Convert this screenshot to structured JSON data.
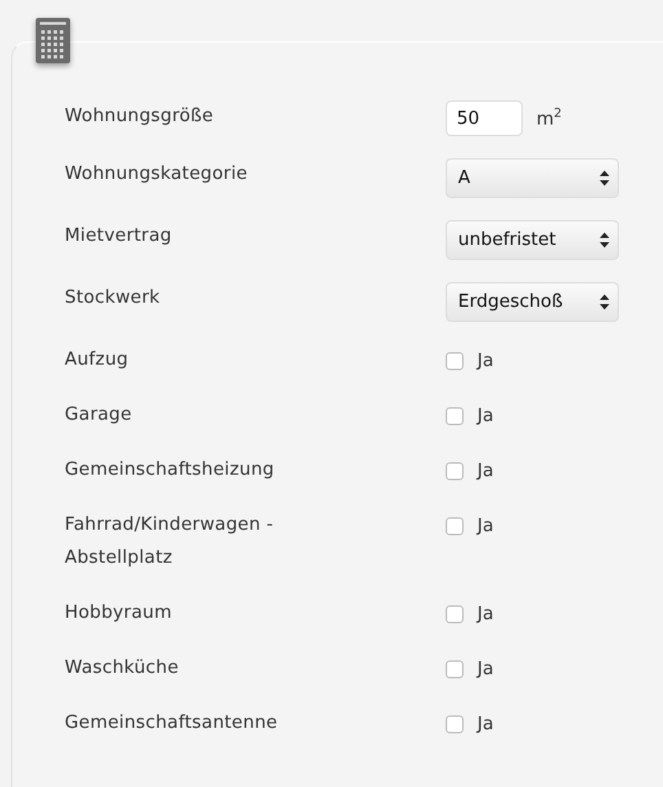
{
  "fields": [
    {
      "kind": "number",
      "label": "Wohnungsgröße",
      "value": "50",
      "unit": "m$^{2}$"
    },
    {
      "kind": "select",
      "label": "Wohnungskategorie",
      "value": "A"
    },
    {
      "kind": "select",
      "label": "Mietvertrag",
      "value": "unbefristet"
    },
    {
      "kind": "select",
      "label": "Stockwerk",
      "value": "Erdgeschoß"
    },
    {
      "kind": "checkbox",
      "label": "Aufzug",
      "option": "Ja",
      "checked": false
    },
    {
      "kind": "checkbox",
      "label": "Garage",
      "option": "Ja",
      "checked": false
    },
    {
      "kind": "checkbox",
      "label": "Gemeinschaftsheizung",
      "option": "Ja",
      "checked": false
    },
    {
      "kind": "checkbox",
      "label": "Fahrrad/Kinderwagen - Abstellplatz",
      "option": "Ja",
      "checked": false
    },
    {
      "kind": "checkbox",
      "label": "Hobbyraum",
      "option": "Ja",
      "checked": false
    },
    {
      "kind": "checkbox",
      "label": "Waschküche",
      "option": "Ja",
      "checked": false
    },
    {
      "kind": "checkbox",
      "label": "Gemeinschaftsantenne",
      "option": "Ja",
      "checked": false
    }
  ]
}
